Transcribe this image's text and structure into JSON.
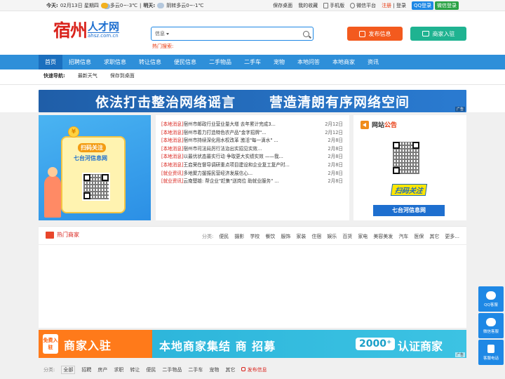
{
  "topbar": {
    "today_label": "今天:",
    "today_date": "02月13日 星期四",
    "today_weather": "多云0~-3℃",
    "tomorrow_label": "明天:",
    "tomorrow_weather": "阴转多云0~-1℃",
    "links": [
      "保存桌面",
      "我的收藏",
      "手机版",
      "微信平台"
    ],
    "register": "注册",
    "login": "登录",
    "qq_login": "QQ登录",
    "wx_login": "微信登录"
  },
  "logo": {
    "big": "宿州",
    "small": "人才网",
    "domain": "ahsz.com.cn"
  },
  "search": {
    "category": "信息",
    "placeholder": "",
    "hot_label": "热门搜索:"
  },
  "header_buttons": {
    "post": "发布信息",
    "merchant": "商家入驻"
  },
  "nav": [
    "首页",
    "招聘信息",
    "求职信息",
    "转让信息",
    "便民信息",
    "二手物品",
    "二手车",
    "宠物",
    "本地问答",
    "本地商家",
    "资讯"
  ],
  "quick": {
    "label": "快速导航:",
    "items": [
      "最新天气",
      "保存到桌面"
    ]
  },
  "banner1": {
    "left": "依法打击整治网络谣言",
    "right": "营造清朗有序网络空间",
    "ad": "广告"
  },
  "promo": {
    "coin": "¥",
    "scan": "扫码关注",
    "name": "七台河信息网"
  },
  "news": [
    {
      "tag": "[本地消息]",
      "title": "宿州市邮政行业营业量大增 去年累计完成3...",
      "date": "2月12日"
    },
    {
      "tag": "[本地消息]",
      "title": "宿州市着力打造特色农产品\"金字招牌\"...",
      "date": "2月12日"
    },
    {
      "tag": "[本地消息]",
      "title": "宿州市持续深化用水权改革 激活\"每一滴水\" ...",
      "date": "2月8日"
    },
    {
      "tag": "[本地消息]",
      "title": "宿州市司法局厉行法治出实招见实效...",
      "date": "2月8日"
    },
    {
      "tag": "[本地消息]",
      "title": "以最优状态最实行动 争取更大实绩实效 ——我...",
      "date": "2月8日"
    },
    {
      "tag": "[本地消息]",
      "title": "王启荣在督导调研重点项目建设和企业复工复产时...",
      "date": "2月8日"
    },
    {
      "tag": "[就业资讯]",
      "title": "多地聚力援振民营经济发展信心...",
      "date": "2月8日"
    },
    {
      "tag": "[就业资讯]",
      "title": "云南楚雄: 帮企业\"赶集\"送岗位 助就业服务\" ...",
      "date": "2月8日"
    }
  ],
  "notice": {
    "title_a": "网站",
    "title_b": "公告",
    "slogan": "扫码关注",
    "footer": "七台河信息网"
  },
  "merchants": {
    "title": "热门商家",
    "filter_label": "分类:",
    "categories": [
      "便民",
      "摄影",
      "学校",
      "餐饮",
      "服饰",
      "家装",
      "住宿",
      "娱乐",
      "百货",
      "家电",
      "美容美发",
      "汽车",
      "医保",
      "其它",
      "更多..."
    ]
  },
  "banner2": {
    "free": "免费入驻",
    "join": "商家入驻",
    "mid": "本地商家集结 商   招募",
    "count": "2000⁺",
    "cert": "认证商家",
    "ad": "广告"
  },
  "bottom_filter": {
    "label": "分类:",
    "items": [
      "全部",
      "招聘",
      "房产",
      "求职",
      "转让",
      "便民",
      "二手物品",
      "二手车",
      "宠物",
      "其它"
    ],
    "post": "发布信息"
  },
  "side": [
    "QQ客服",
    "微信客服",
    "客服电话"
  ]
}
